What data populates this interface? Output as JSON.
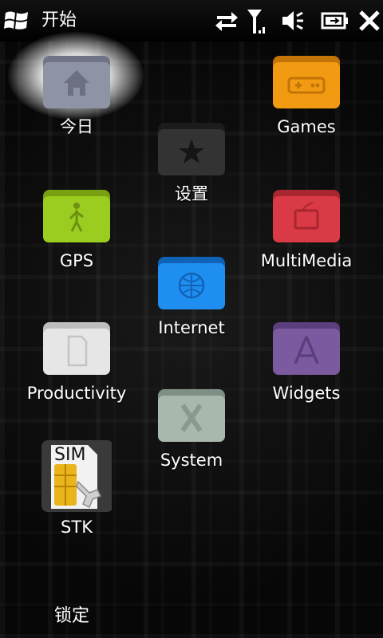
{
  "statusbar": {
    "title": "开始",
    "icons": [
      "windows-start-icon",
      "data-sync-icon",
      "signal-icon",
      "volume-icon",
      "battery-icon",
      "close-icon"
    ]
  },
  "tiles": [
    {
      "name": "today",
      "label": "今日",
      "color": "#8f93a6",
      "icon": "home-icon",
      "selected": true
    },
    {
      "name": "settings",
      "label": "设置",
      "color": "#333333",
      "icon": "star-icon"
    },
    {
      "name": "games",
      "label": "Games",
      "color": "#f29a12",
      "icon": "gamepad-icon"
    },
    {
      "name": "gps",
      "label": "GPS",
      "color": "#9acd1f",
      "icon": "walker-icon"
    },
    {
      "name": "multimedia",
      "label": "MultiMedia",
      "color": "#d93a45",
      "icon": "tv-icon"
    },
    {
      "name": "internet",
      "label": "Internet",
      "color": "#1e8ef0",
      "icon": "globe-icon"
    },
    {
      "name": "productivity",
      "label": "Productivity",
      "color": "#e6e6e6",
      "icon": "document-icon"
    },
    {
      "name": "widgets",
      "label": "Widgets",
      "color": "#7b5aa0",
      "icon": "app-a-icon"
    },
    {
      "name": "system",
      "label": "System",
      "color": "#a8b8ad",
      "icon": "x-icon"
    },
    {
      "name": "stk",
      "label": "STK",
      "color": "#f2f2f2",
      "icon": "sim-icon",
      "sim_text": "SIM"
    }
  ],
  "softkey": {
    "left_label": "锁定"
  }
}
